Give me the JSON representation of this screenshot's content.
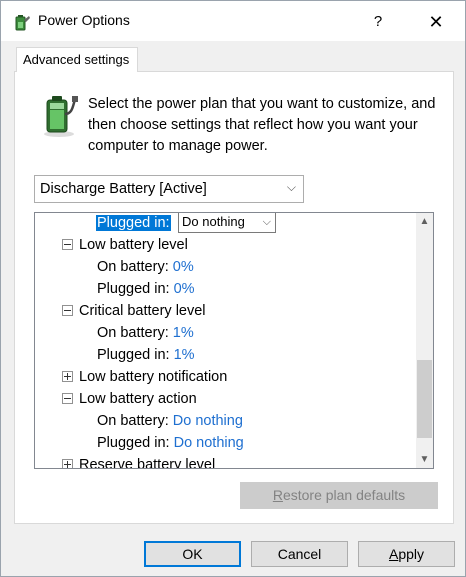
{
  "window": {
    "title": "Power Options",
    "help_glyph": "?",
    "close_glyph": "✕"
  },
  "tabs": [
    {
      "label": "Advanced settings"
    }
  ],
  "intro_text": "Select the power plan that you want to customize, and then choose settings that reflect how you want your computer to manage power.",
  "plan_select": {
    "value": "Discharge Battery [Active]",
    "chevron": "⌵"
  },
  "tree": {
    "selected_row": {
      "label": "Plugged in:",
      "dropdown_value": "Do nothing",
      "chevron": "⌵"
    },
    "items": [
      {
        "type": "group",
        "expander": "minus",
        "label": "Low battery level"
      },
      {
        "type": "setting",
        "label": "On battery:",
        "value": "0%"
      },
      {
        "type": "setting",
        "label": "Plugged in:",
        "value": "0%"
      },
      {
        "type": "group",
        "expander": "minus",
        "label": "Critical battery level"
      },
      {
        "type": "setting",
        "label": "On battery:",
        "value": "1%"
      },
      {
        "type": "setting",
        "label": "Plugged in:",
        "value": "1%"
      },
      {
        "type": "group",
        "expander": "plus",
        "label": "Low battery notification"
      },
      {
        "type": "group",
        "expander": "minus",
        "label": "Low battery action"
      },
      {
        "type": "setting",
        "label": "On battery:",
        "value": "Do nothing"
      },
      {
        "type": "setting",
        "label": "Plugged in:",
        "value": "Do nothing"
      },
      {
        "type": "group",
        "expander": "plus",
        "label": "Reserve battery level"
      }
    ],
    "scroll_up_glyph": "▲",
    "scroll_down_glyph": "▼"
  },
  "buttons": {
    "restore_first": "R",
    "restore_rest": "estore plan defaults",
    "ok": "OK",
    "cancel": "Cancel",
    "apply_first": "A",
    "apply_rest": "pply"
  },
  "colors": {
    "value_link": "#1e6fd0",
    "selection": "#0078d7",
    "dialog_bg": "#f0f0f0"
  },
  "icons": {
    "app": "power-options-icon",
    "battery": "battery-plug-icon"
  }
}
